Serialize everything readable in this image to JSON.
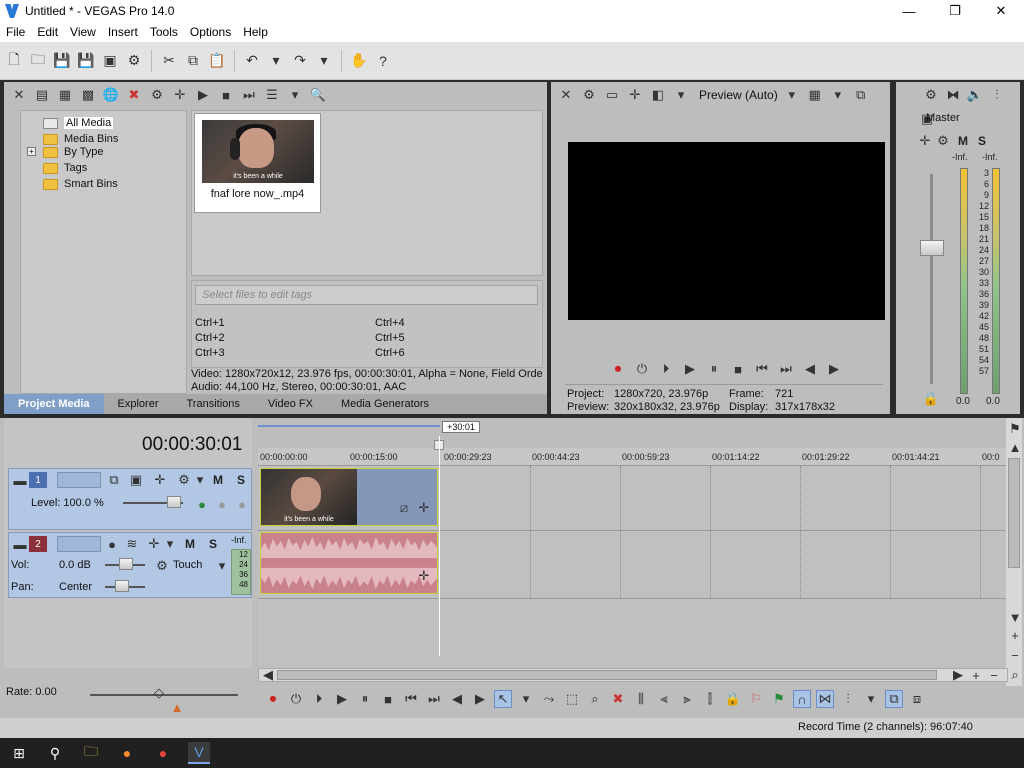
{
  "window": {
    "title": "Untitled * - VEGAS Pro 14.0",
    "minimize": "—",
    "maximize": "❐",
    "close": "✕"
  },
  "menu": [
    "File",
    "Edit",
    "View",
    "Insert",
    "Tools",
    "Options",
    "Help"
  ],
  "project_media": {
    "tree": [
      {
        "label": "All Media",
        "selected": true
      },
      {
        "label": "Media Bins"
      },
      {
        "label": "By Type",
        "expandable": true
      },
      {
        "label": "Tags"
      },
      {
        "label": "Smart Bins"
      }
    ],
    "media_file": {
      "name": "fnaf lore now_.mp4",
      "thumb_caption": "it's been a while"
    },
    "tags_placeholder": "Select files to edit tags",
    "shortcuts": [
      "Ctrl+1",
      "Ctrl+4",
      "Ctrl+2",
      "Ctrl+5",
      "Ctrl+3",
      "Ctrl+6"
    ],
    "info_video": "Video: 1280x720x12, 23.976 fps, 00:00:30:01, Alpha = None, Field Orde",
    "info_audio": "Audio: 44,100 Hz, Stereo, 00:00:30:01, AAC",
    "tabs": [
      "Project Media",
      "Explorer",
      "Transitions",
      "Video FX",
      "Media Generators"
    ]
  },
  "preview": {
    "mode": "Preview (Auto)",
    "project_label": "Project:",
    "project_value": "1280x720, 23.976p",
    "preview_label": "Preview:",
    "preview_value": "320x180x32, 23.976p",
    "frame_label": "Frame:",
    "frame_value": "721",
    "display_label": "Display:",
    "display_value": "317x178x32"
  },
  "master": {
    "label": "Master",
    "m": "M",
    "s": "S",
    "inf_left": "-Inf.",
    "inf_right": "-Inf.",
    "scale": [
      "3",
      "6",
      "9",
      "12",
      "15",
      "18",
      "21",
      "24",
      "27",
      "30",
      "33",
      "36",
      "39",
      "42",
      "45",
      "48",
      "51",
      "54",
      "57"
    ],
    "value_left": "0.0",
    "value_right": "0.0"
  },
  "timeline": {
    "current_time": "00:00:30:01",
    "loop_label": "+30:01",
    "ruler": [
      "00:00:00:00",
      "00:00:15:00",
      "00:00:29:23",
      "00:00:44:23",
      "00:00:59:23",
      "00:01:14:22",
      "00:01:29:22",
      "00:01:44:21",
      "00:0"
    ],
    "video_track": {
      "number": "1",
      "level_label": "Level: 100.0 %",
      "m": "M",
      "s": "S",
      "caption": "it's been a while"
    },
    "audio_track": {
      "number": "2",
      "vol_label": "Vol:",
      "vol_value": "0.0 dB",
      "pan_label": "Pan:",
      "pan_value": "Center",
      "mode": "Touch",
      "m": "M",
      "s": "S",
      "inf": "-Inf.",
      "scale": [
        "12",
        "24",
        "36",
        "48"
      ]
    },
    "rate_label": "Rate: 0.00"
  },
  "status": {
    "record_time": "Record Time (2 channels): 96:07:40"
  }
}
